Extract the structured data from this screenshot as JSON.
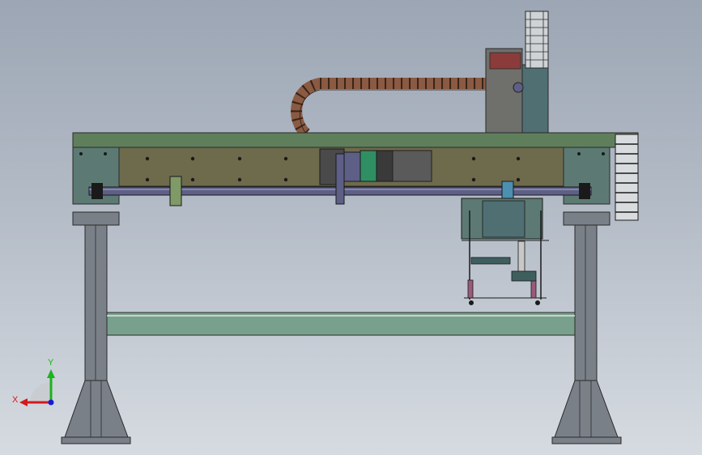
{
  "scene": {
    "view": "front",
    "subject": "gantry-machine-assembly"
  },
  "triad": {
    "x_label": "X",
    "y_label": "Y",
    "x_color": "#d41a1a",
    "y_color": "#1db31d",
    "z_color": "#1a1ad4"
  },
  "colors": {
    "background_top": "#9ca6b4",
    "background_bottom": "#d6dbe1",
    "frame_green": "#5f7f5c",
    "plate_olive": "#6e6a4c",
    "leg_gray": "#7a8088",
    "crossbar_green": "#79a08c",
    "cable_chain": "#8a5a43",
    "shaft": "#5d5f86",
    "motor_green": "#2f8f63",
    "teal_blocks": "#3f6f6f"
  }
}
